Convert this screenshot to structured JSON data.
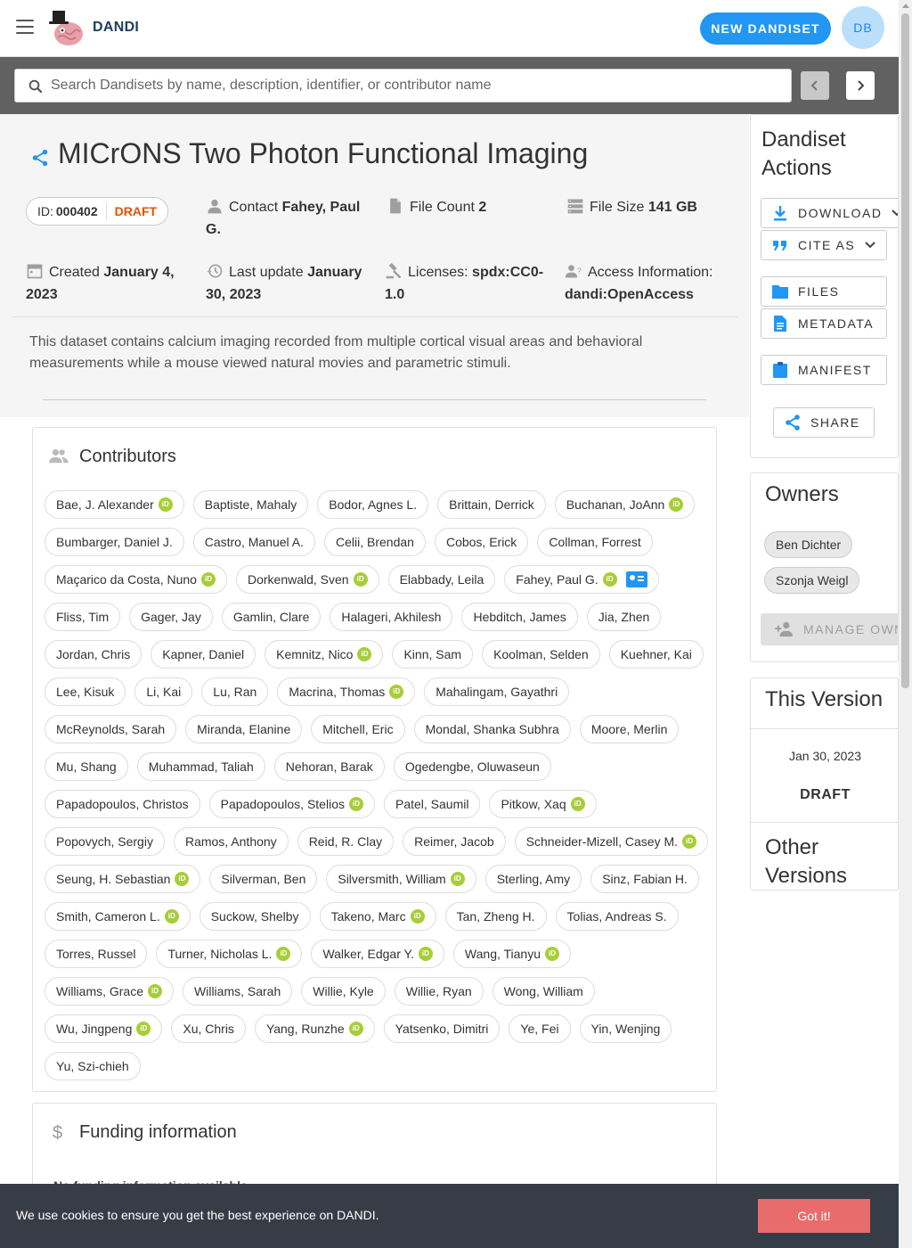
{
  "header": {
    "brand": "DANDI",
    "new_dandiset_label": "NEW DANDISET",
    "user_initials": "DB"
  },
  "search": {
    "placeholder": "Search Dandisets by name, description, identifier, or contributor name"
  },
  "dandiset": {
    "title": "MICrONS Two Photon Functional Imaging",
    "id_label": "ID:",
    "id": "000402",
    "status": "DRAFT",
    "contact_label": "Contact",
    "contact_name": "Fahey, Paul G.",
    "file_count_label": "File Count",
    "file_count": "2",
    "file_size_label": "File Size",
    "file_size": "141 GB",
    "created_label": "Created",
    "created": "January 4, 2023",
    "last_update_label": "Last update",
    "last_update": "January 30, 2023",
    "licenses_label": "Licenses:",
    "licenses": "spdx:CC0-1.0",
    "access_label": "Access Information:",
    "access": "dandi:OpenAccess",
    "description": "This dataset contains calcium imaging recorded from multiple cortical visual areas and behavioral measurements while a mouse viewed natural movies and parametric stimuli."
  },
  "contributors": {
    "title": "Contributors",
    "rows": [
      [
        {
          "name": "Bae, J. Alexander",
          "orcid": true
        },
        {
          "name": "Baptiste, Mahaly"
        },
        {
          "name": "Bodor, Agnes L."
        },
        {
          "name": "Brittain, Derrick"
        },
        {
          "name": "Buchanan, JoAnn",
          "orcid": true
        }
      ],
      [
        {
          "name": "Bumbarger, Daniel J."
        },
        {
          "name": "Castro, Manuel A."
        },
        {
          "name": "Celii, Brendan"
        },
        {
          "name": "Cobos, Erick"
        },
        {
          "name": "Collman, Forrest"
        }
      ],
      [
        {
          "name": "Maçarico da Costa, Nuno",
          "orcid": true
        },
        {
          "name": "Dorkenwald, Sven",
          "orcid": true
        },
        {
          "name": "Elabbady, Leila"
        },
        {
          "name": "Fahey, Paul G.",
          "orcid": true,
          "contact": true
        }
      ],
      [
        {
          "name": "Fliss, Tim"
        },
        {
          "name": "Gager, Jay"
        },
        {
          "name": "Gamlin, Clare"
        },
        {
          "name": "Halageri, Akhilesh"
        },
        {
          "name": "Hebditch, James"
        },
        {
          "name": "Jia, Zhen"
        }
      ],
      [
        {
          "name": "Jordan, Chris"
        },
        {
          "name": "Kapner, Daniel"
        },
        {
          "name": "Kemnitz, Nico",
          "orcid": true
        },
        {
          "name": "Kinn, Sam"
        },
        {
          "name": "Koolman, Selden"
        },
        {
          "name": "Kuehner, Kai"
        }
      ],
      [
        {
          "name": "Lee, Kisuk"
        },
        {
          "name": "Li, Kai"
        },
        {
          "name": "Lu, Ran"
        },
        {
          "name": "Macrina, Thomas",
          "orcid": true
        },
        {
          "name": "Mahalingam, Gayathri"
        }
      ],
      [
        {
          "name": "McReynolds, Sarah"
        },
        {
          "name": "Miranda, Elanine"
        },
        {
          "name": "Mitchell, Eric"
        },
        {
          "name": "Mondal, Shanka Subhra"
        },
        {
          "name": "Moore, Merlin"
        }
      ],
      [
        {
          "name": "Mu, Shang"
        },
        {
          "name": "Muhammad, Taliah"
        },
        {
          "name": "Nehoran, Barak"
        },
        {
          "name": "Ogedengbe, Oluwaseun"
        }
      ],
      [
        {
          "name": "Papadopoulos, Christos"
        },
        {
          "name": "Papadopoulos, Stelios",
          "orcid": true
        },
        {
          "name": "Patel, Saumil"
        },
        {
          "name": "Pitkow, Xaq",
          "orcid": true
        }
      ],
      [
        {
          "name": "Popovych, Sergiy"
        },
        {
          "name": "Ramos, Anthony"
        },
        {
          "name": "Reid, R. Clay"
        },
        {
          "name": "Reimer, Jacob"
        },
        {
          "name": "Schneider-Mizell, Casey M.",
          "orcid": true
        }
      ],
      [
        {
          "name": "Seung, H. Sebastian",
          "orcid": true
        },
        {
          "name": "Silverman, Ben"
        },
        {
          "name": "Silversmith, William",
          "orcid": true
        },
        {
          "name": "Sterling, Amy"
        },
        {
          "name": "Sinz, Fabian H."
        }
      ],
      [
        {
          "name": "Smith, Cameron L.",
          "orcid": true
        },
        {
          "name": "Suckow, Shelby"
        },
        {
          "name": "Takeno, Marc",
          "orcid": true
        },
        {
          "name": "Tan, Zheng H."
        },
        {
          "name": "Tolias, Andreas S."
        }
      ],
      [
        {
          "name": "Torres, Russel"
        },
        {
          "name": "Turner, Nicholas L.",
          "orcid": true
        },
        {
          "name": "Walker, Edgar Y.",
          "orcid": true
        },
        {
          "name": "Wang, Tianyu",
          "orcid": true
        }
      ],
      [
        {
          "name": "Williams, Grace",
          "orcid": true
        },
        {
          "name": "Williams, Sarah"
        },
        {
          "name": "Willie, Kyle"
        },
        {
          "name": "Willie, Ryan"
        },
        {
          "name": "Wong, William"
        }
      ],
      [
        {
          "name": "Wu, Jingpeng",
          "orcid": true
        },
        {
          "name": "Xu, Chris"
        },
        {
          "name": "Yang, Runzhe",
          "orcid": true
        },
        {
          "name": "Yatsenko, Dimitri"
        },
        {
          "name": "Ye, Fei"
        },
        {
          "name": "Yin, Wenjing"
        }
      ],
      [
        {
          "name": "Yu, Szi-chieh"
        }
      ]
    ]
  },
  "funding": {
    "title": "Funding information",
    "peek": "No funding information available"
  },
  "sidebar": {
    "actions_title": "Dandiset Actions",
    "download_label": "DOWNLOAD",
    "cite_label": "CITE AS",
    "files_label": "FILES",
    "metadata_label": "METADATA",
    "manifest_label": "MANIFEST",
    "share_label": "SHARE",
    "owners_title": "Owners",
    "owners": [
      "Ben Dichter",
      "Szonja Weigl"
    ],
    "manage_owners_label": "MANAGE OWNERS",
    "this_version_title": "This Version",
    "version_date": "Jan 30, 2023",
    "version_status": "DRAFT",
    "other_versions_title": "Other Versions"
  },
  "cookie": {
    "text": "We use cookies to ensure you get the best experience on DANDI.",
    "button": "Got it!"
  },
  "colors": {
    "primary": "#2196f3",
    "draft": "#e65100",
    "orcid": "#a6ce39",
    "cookie_button": "#e86c6c"
  }
}
